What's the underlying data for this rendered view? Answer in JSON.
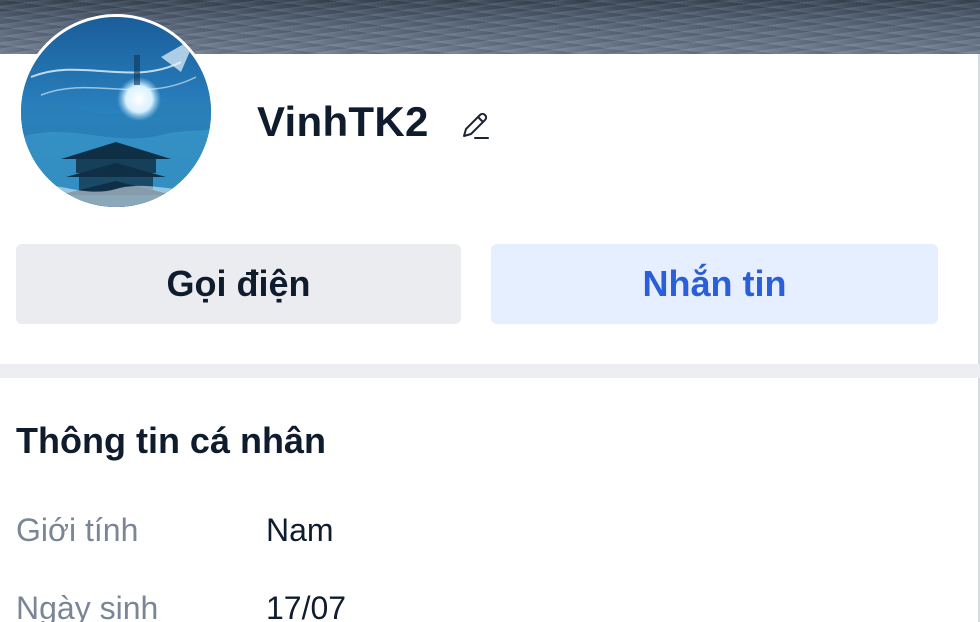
{
  "profile": {
    "display_name": "VinhTK2",
    "avatar_icon": "avatar-image",
    "edit_icon": "pencil-icon"
  },
  "actions": {
    "call_label": "Gọi điện",
    "message_label": "Nhắn tin"
  },
  "personal_info": {
    "title": "Thông tin cá nhân",
    "rows": [
      {
        "label": "Giới tính",
        "value": "Nam"
      },
      {
        "label": "Ngày sinh",
        "value": "17/07"
      }
    ]
  },
  "colors": {
    "message_button_bg": "#e6efff",
    "message_button_text": "#2b5fd9",
    "call_button_bg": "#eaecf0",
    "text_primary": "#0f1c2e",
    "text_muted": "#7a8595"
  }
}
